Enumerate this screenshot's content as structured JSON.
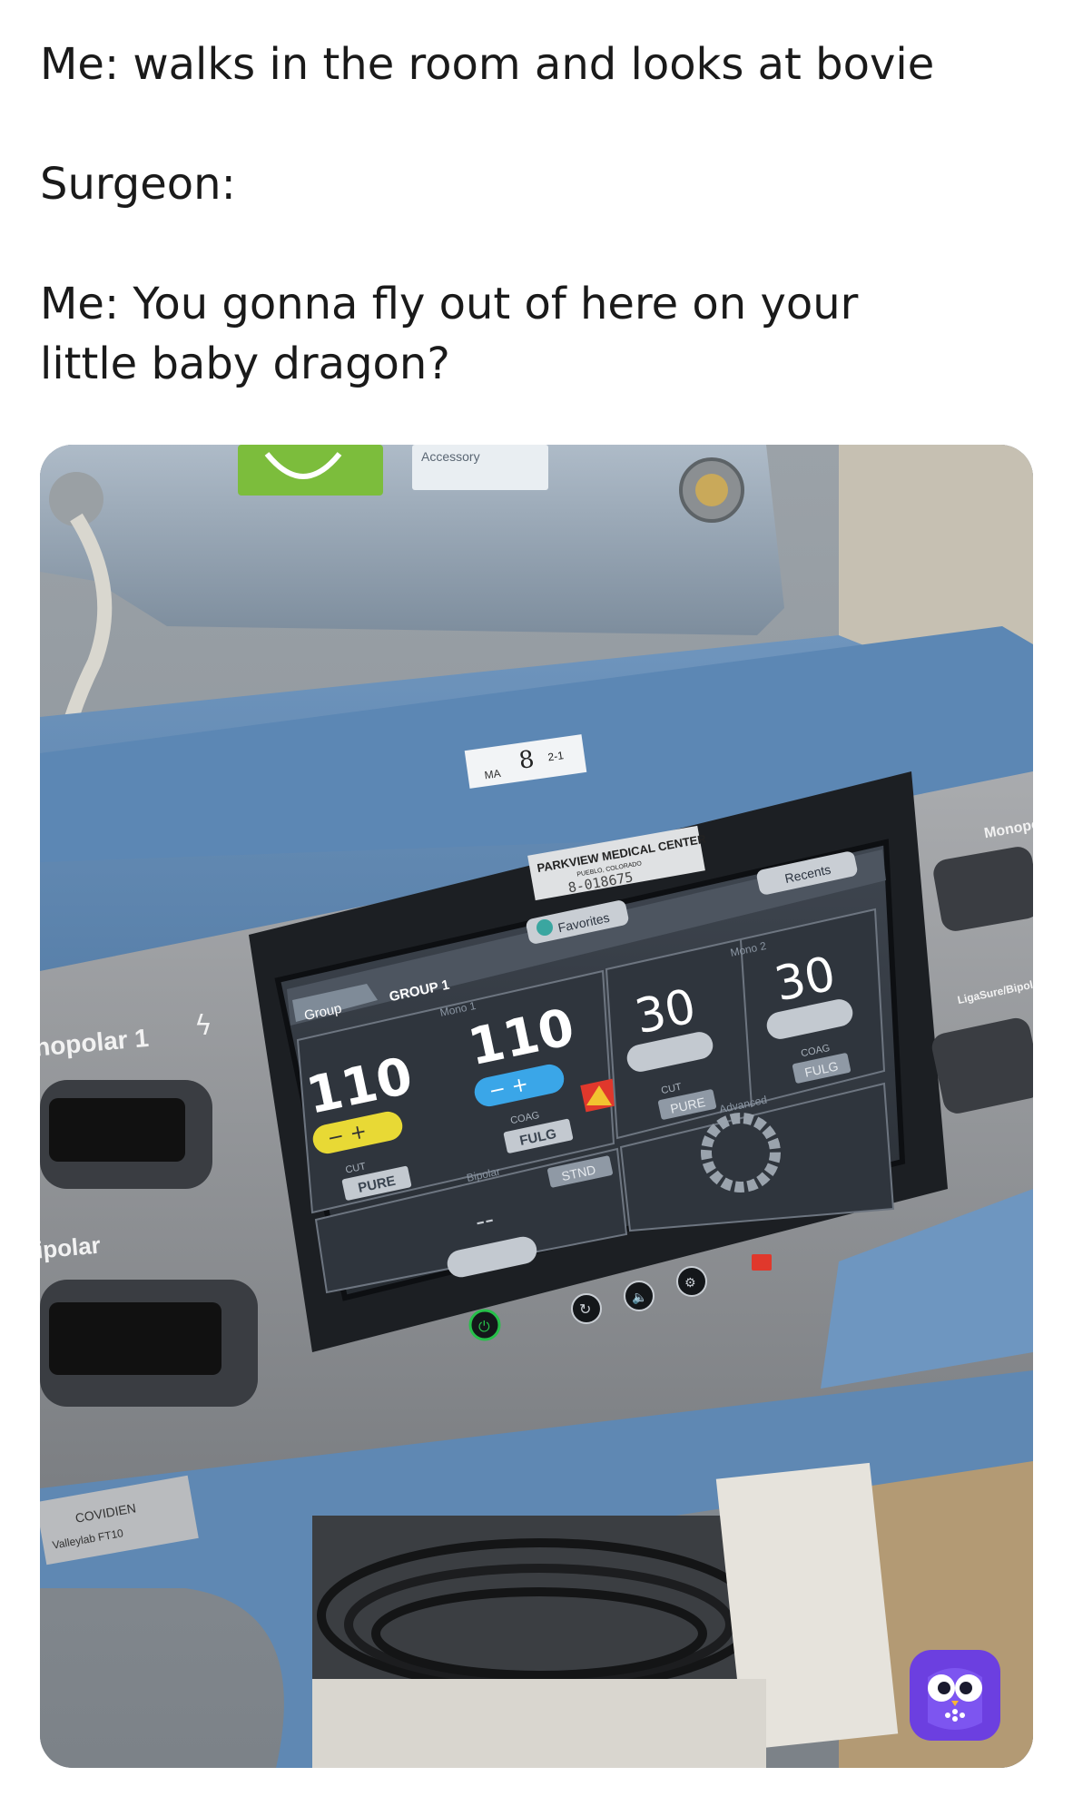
{
  "caption": {
    "line1": "Me: walks in the room and looks at bovie",
    "line2": "Surgeon:",
    "line3": "Me: You gonna fly out of here on your",
    "line4": "little baby dragon?"
  },
  "photo": {
    "top_unit": {
      "accessory_label": "Accessory"
    },
    "sticker": {
      "number": "8",
      "date": "2-1",
      "initials": "MA"
    },
    "asset_tag": {
      "hospital": "PARKVIEW MEDICAL CENTER",
      "city": "PUEBLO, COLORADO",
      "asset_number": "8-018675"
    },
    "side_labels": {
      "left_mono": "nopolar 1",
      "left_bipolar": "ipolar",
      "right_mono": "Monopo",
      "right_liga": "LigaSure/Bipol"
    },
    "screen": {
      "recents": "Recents",
      "favorites": "Favorites",
      "group_tab": "Group",
      "group_name": "GROUP 1",
      "mono1": {
        "label": "Mono 1",
        "cut_value": "110",
        "cut_label": "CUT",
        "cut_mode": "PURE",
        "coag_value": "110",
        "coag_label": "COAG",
        "coag_mode": "FULG"
      },
      "mono2": {
        "label": "Mono 2",
        "cut_value": "30",
        "cut_label": "CUT",
        "cut_mode": "PURE",
        "coag_value": "30",
        "coag_label": "COAG",
        "coag_mode": "FULG"
      },
      "bipolar": {
        "label": "Bipolar",
        "value": "--",
        "mode": "STND"
      },
      "advanced": "Advanced"
    },
    "brand": {
      "name": "COVIDIEN",
      "model": "Valleylab FT10"
    },
    "colors": {
      "cut_yellow": "#e8d935",
      "coag_blue": "#3aa6e8",
      "warning": "#e0382c",
      "power_green": "#27c04a"
    }
  }
}
